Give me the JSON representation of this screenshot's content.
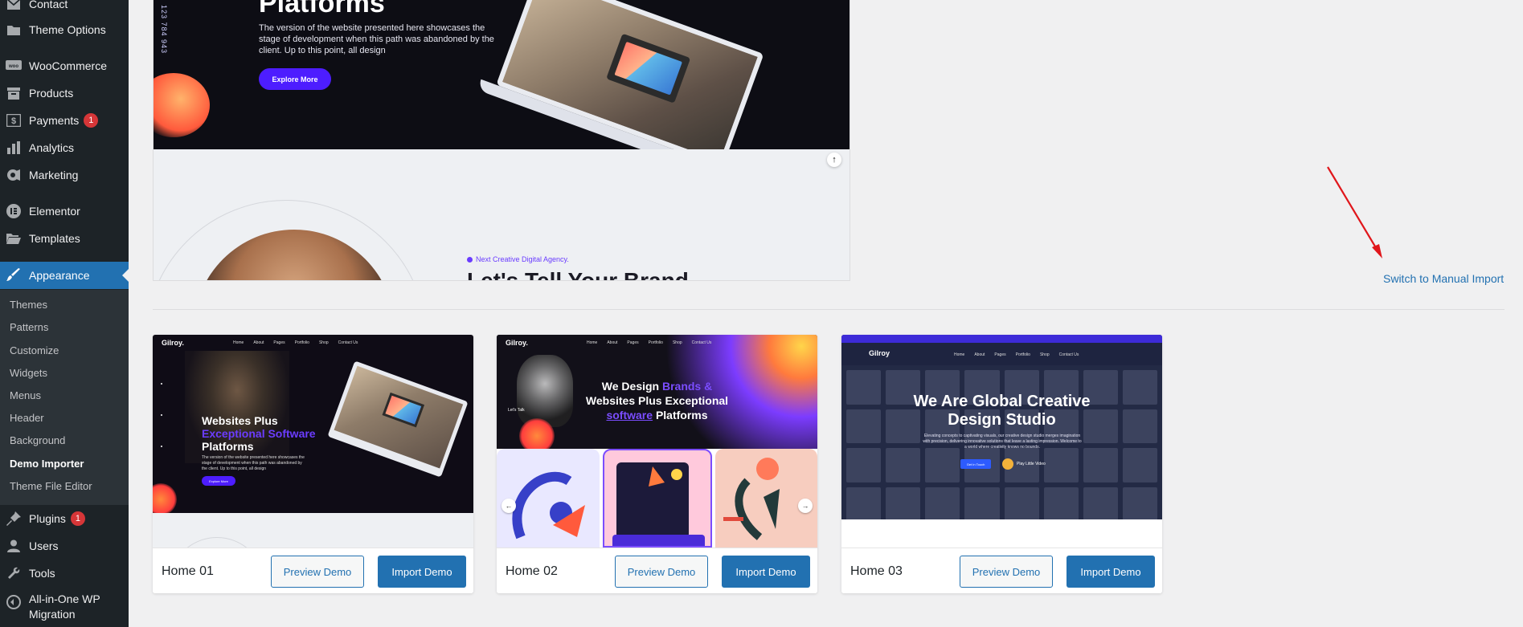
{
  "sidebar": {
    "items": [
      {
        "label": "Contact",
        "icon": "envelope-icon",
        "badge": ""
      },
      {
        "label": "Theme Options",
        "icon": "folder-icon",
        "badge": ""
      },
      {
        "label": "WooCommerce",
        "icon": "woo-icon",
        "badge": ""
      },
      {
        "label": "Products",
        "icon": "archive-icon",
        "badge": ""
      },
      {
        "label": "Payments",
        "icon": "dollar-icon",
        "badge": "1"
      },
      {
        "label": "Analytics",
        "icon": "bar-chart-icon",
        "badge": ""
      },
      {
        "label": "Marketing",
        "icon": "megaphone-icon",
        "badge": ""
      },
      {
        "label": "Elementor",
        "icon": "elementor-icon",
        "badge": ""
      },
      {
        "label": "Templates",
        "icon": "folder-open-icon",
        "badge": ""
      },
      {
        "label": "Appearance",
        "icon": "paintbrush-icon",
        "badge": ""
      },
      {
        "label": "Plugins",
        "icon": "plug-icon",
        "badge": "1"
      },
      {
        "label": "Users",
        "icon": "user-icon",
        "badge": ""
      },
      {
        "label": "Tools",
        "icon": "wrench-icon",
        "badge": ""
      },
      {
        "label": "All-in-One WP Migration",
        "icon": "migration-icon",
        "badge": ""
      }
    ],
    "submenu": [
      "Themes",
      "Patterns",
      "Customize",
      "Widgets",
      "Menus",
      "Header",
      "Background",
      "Demo Importer",
      "Theme File Editor"
    ],
    "current_sub": "Demo Importer"
  },
  "top_preview": {
    "hero_title": "Platforms",
    "hero_desc": "The version of the website presented here showcases the stage of development when this path was abandoned by the client. Up to this point, all design",
    "hero_button": "Explore More",
    "phone": "123 784 943",
    "agency_tag": "Next Creative Digital Agency.",
    "agency_title": "Let's Tell Your Brand"
  },
  "manual_import_link": "Switch to Manual Import",
  "cards": [
    {
      "name": "Home 01",
      "preview_label": "Preview Demo",
      "import_label": "Import Demo",
      "shot": {
        "logo": "Gilroy.",
        "nav": [
          "Home",
          "About",
          "Pages",
          "Portfolio",
          "Shop",
          "Contact Us"
        ],
        "title_1": "Websites Plus",
        "title_hl": "Exceptional Software",
        "title_2": "Platforms",
        "desc": "The version of the website presented here showcases the stage of development when this path was abandoned by the client. Up to this point, all design",
        "button": "Explore More"
      }
    },
    {
      "name": "Home 02",
      "preview_label": "Preview Demo",
      "import_label": "Import Demo",
      "shot": {
        "logo": "Gilroy.",
        "nav": [
          "Home",
          "About",
          "Pages",
          "Portfolio",
          "Shop",
          "Contact Us"
        ],
        "title_1": "We Design",
        "title_p1": "Brands &",
        "title_2": "Websites Plus Exceptional",
        "title_u": "software",
        "title_3": "Platforms",
        "lets_talk": "Let's Talk"
      }
    },
    {
      "name": "Home 03",
      "preview_label": "Preview Demo",
      "import_label": "Import Demo",
      "shot": {
        "logo": "Gilroy",
        "nav": [
          "Home",
          "About",
          "Pages",
          "Portfolio",
          "Shop",
          "Contact Us"
        ],
        "title": "We Are Global Creative Design Studio",
        "desc": "Elevating concepts to captivating visuals, our creative design studio merges imagination with precision, delivering innovative solutions that leave a lasting impression. Welcome to a world where creativity knows no bounds.",
        "button": "Get In Touch",
        "play": "Play Little Video"
      }
    }
  ],
  "colors": {
    "sidebar_bg": "#1d2327",
    "accent": "#2271b1",
    "badge": "#d63638",
    "arrow": "#e0161b"
  }
}
